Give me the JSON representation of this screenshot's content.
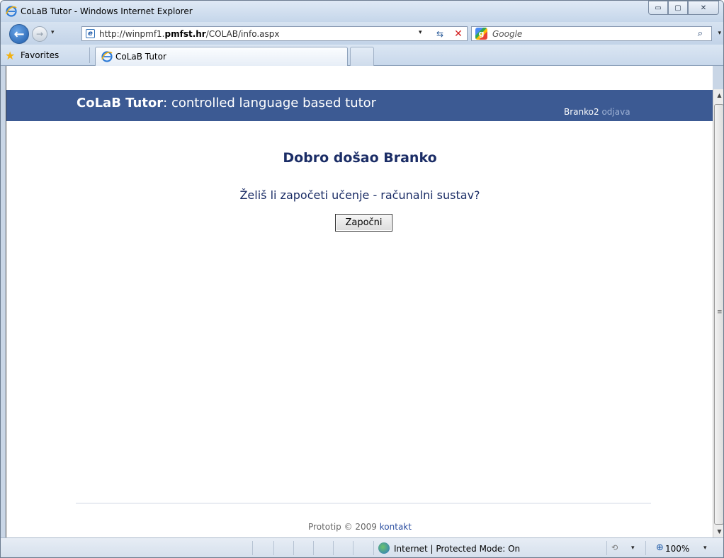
{
  "window": {
    "title": "CoLaB Tutor - Windows Internet Explorer",
    "minimize_glyph": "▭",
    "maximize_glyph": "▢",
    "close_glyph": "✕"
  },
  "nav": {
    "url_prefix": "http://winpmf1.",
    "url_domain": "pmfst.hr",
    "url_path": "/COLAB/info.aspx",
    "search_placeholder": "Google",
    "dropdown_glyph": "▾"
  },
  "favbar": {
    "favorites_label": "Favorites",
    "tab_label": "CoLaB Tutor"
  },
  "page": {
    "brand_name": "CoLaB Tutor",
    "brand_tagline": ": controlled language based tutor",
    "username": "Branko2",
    "logout_label": "odjava",
    "welcome_title": "Dobro došao Branko",
    "question": "Želiš li započeti učenje - računalni sustav?",
    "start_button": "Započni",
    "footer_text": "Prototip © 2009",
    "footer_link": "kontakt"
  },
  "status": {
    "zone_text": "Internet | Protected Mode: On",
    "zoom": "100%"
  },
  "colors": {
    "header_bg": "#3c5a93",
    "heading_text": "#1b2d66",
    "link": "#2a4da0",
    "logout_link": "#9fb2d5"
  },
  "icons": [
    "ie-icon",
    "back-arrow-icon",
    "forward-arrow-icon",
    "page-icon",
    "refresh-icon",
    "stop-icon",
    "google-icon",
    "search-icon",
    "favorites-star-icon",
    "globe-icon",
    "protected-mode-icon",
    "zoom-icon"
  ]
}
